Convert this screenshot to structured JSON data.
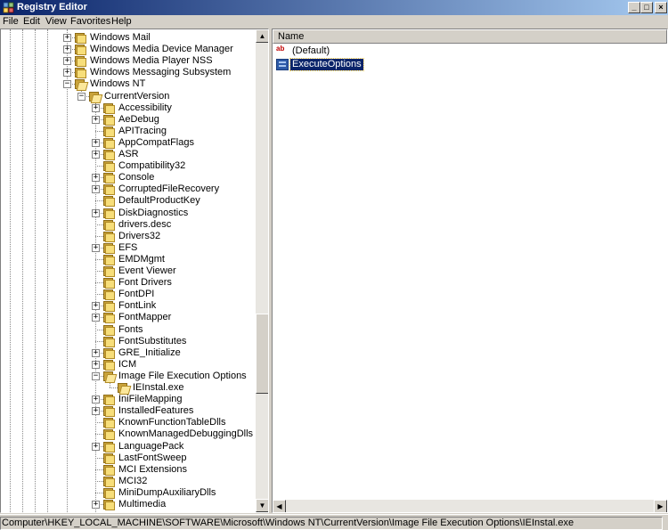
{
  "window": {
    "title": "Registry Editor",
    "minimize_glyph": "_",
    "maximize_glyph": "□",
    "close_glyph": "×"
  },
  "menu": {
    "items": [
      "File",
      "Edit",
      "View",
      "Favorites",
      "Help"
    ]
  },
  "tree": {
    "nodes": [
      {
        "label": "Windows Mail",
        "level": 0,
        "expander": "plus"
      },
      {
        "label": "Windows Media Device Manager",
        "level": 0,
        "expander": "plus"
      },
      {
        "label": "Windows Media Player NSS",
        "level": 0,
        "expander": "plus"
      },
      {
        "label": "Windows Messaging Subsystem",
        "level": 0,
        "expander": "plus"
      },
      {
        "label": "Windows NT",
        "level": 0,
        "expander": "minus",
        "open": true
      },
      {
        "label": "CurrentVersion",
        "level": 1,
        "expander": "minus",
        "open": true
      },
      {
        "label": "Accessibility",
        "level": 2,
        "expander": "plus"
      },
      {
        "label": "AeDebug",
        "level": 2,
        "expander": "plus"
      },
      {
        "label": "APITracing",
        "level": 2,
        "expander": "none"
      },
      {
        "label": "AppCompatFlags",
        "level": 2,
        "expander": "plus"
      },
      {
        "label": "ASR",
        "level": 2,
        "expander": "plus"
      },
      {
        "label": "Compatibility32",
        "level": 2,
        "expander": "none"
      },
      {
        "label": "Console",
        "level": 2,
        "expander": "plus"
      },
      {
        "label": "CorruptedFileRecovery",
        "level": 2,
        "expander": "plus"
      },
      {
        "label": "DefaultProductKey",
        "level": 2,
        "expander": "none"
      },
      {
        "label": "DiskDiagnostics",
        "level": 2,
        "expander": "plus"
      },
      {
        "label": "drivers.desc",
        "level": 2,
        "expander": "none"
      },
      {
        "label": "Drivers32",
        "level": 2,
        "expander": "none"
      },
      {
        "label": "EFS",
        "level": 2,
        "expander": "plus"
      },
      {
        "label": "EMDMgmt",
        "level": 2,
        "expander": "none"
      },
      {
        "label": "Event Viewer",
        "level": 2,
        "expander": "none"
      },
      {
        "label": "Font Drivers",
        "level": 2,
        "expander": "none"
      },
      {
        "label": "FontDPI",
        "level": 2,
        "expander": "none"
      },
      {
        "label": "FontLink",
        "level": 2,
        "expander": "plus"
      },
      {
        "label": "FontMapper",
        "level": 2,
        "expander": "plus"
      },
      {
        "label": "Fonts",
        "level": 2,
        "expander": "none"
      },
      {
        "label": "FontSubstitutes",
        "level": 2,
        "expander": "none"
      },
      {
        "label": "GRE_Initialize",
        "level": 2,
        "expander": "plus"
      },
      {
        "label": "ICM",
        "level": 2,
        "expander": "plus"
      },
      {
        "label": "Image File Execution Options",
        "level": 2,
        "expander": "minus",
        "open": true
      },
      {
        "label": "IEInstal.exe",
        "level": 3,
        "expander": "none",
        "open": true
      },
      {
        "label": "IniFileMapping",
        "level": 2,
        "expander": "plus"
      },
      {
        "label": "InstalledFeatures",
        "level": 2,
        "expander": "plus"
      },
      {
        "label": "KnownFunctionTableDlls",
        "level": 2,
        "expander": "none"
      },
      {
        "label": "KnownManagedDebuggingDlls",
        "level": 2,
        "expander": "none"
      },
      {
        "label": "LanguagePack",
        "level": 2,
        "expander": "plus"
      },
      {
        "label": "LastFontSweep",
        "level": 2,
        "expander": "none"
      },
      {
        "label": "MCI Extensions",
        "level": 2,
        "expander": "none"
      },
      {
        "label": "MCI32",
        "level": 2,
        "expander": "none"
      },
      {
        "label": "MiniDumpAuxiliaryDlls",
        "level": 2,
        "expander": "none"
      },
      {
        "label": "Multimedia",
        "level": 2,
        "expander": "plus"
      }
    ],
    "scroll_position": 0.72
  },
  "values": {
    "column_name": "Name",
    "items": [
      {
        "name": "(Default)",
        "type": "string",
        "icon_text": "ab",
        "selected": false
      },
      {
        "name": "ExecuteOptions",
        "type": "binary",
        "icon_text": "",
        "selected": true
      }
    ]
  },
  "status": {
    "path": "Computer\\HKEY_LOCAL_MACHINE\\SOFTWARE\\Microsoft\\Windows NT\\CurrentVersion\\Image File Execution Options\\IEInstal.exe"
  },
  "scroll_glyphs": {
    "up": "▲",
    "down": "▼",
    "left": "◀",
    "right": "▶"
  },
  "colors": {
    "selection": "#0a246a",
    "title_gradient_start": "#0a246a",
    "title_gradient_end": "#a6caf0"
  }
}
